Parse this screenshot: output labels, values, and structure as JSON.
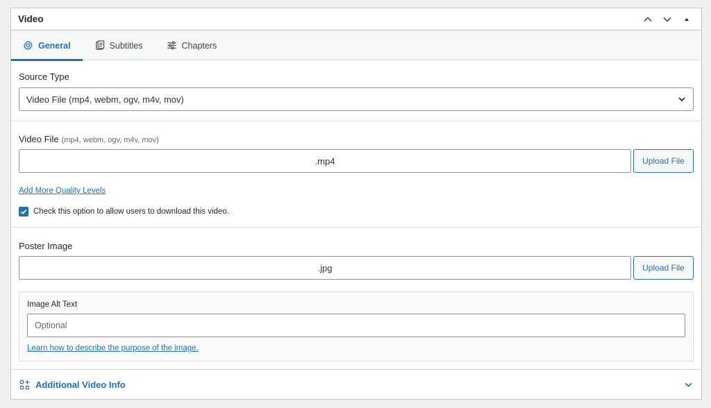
{
  "panel": {
    "title": "Video"
  },
  "tabs": [
    {
      "label": "General",
      "icon": "gear-icon",
      "active": true
    },
    {
      "label": "Subtitles",
      "icon": "subtitles-icon",
      "active": false
    },
    {
      "label": "Chapters",
      "icon": "sliders-icon",
      "active": false
    }
  ],
  "source_type": {
    "label": "Source Type",
    "selected": "Video File (mp4, webm, ogv, m4v, mov)"
  },
  "video_file": {
    "label": "Video File",
    "hint": "(mp4, webm, ogv, m4v, mov)",
    "value": ".mp4",
    "upload_label": "Upload File",
    "add_quality_link": "Add More Quality Levels",
    "download_checkbox_label": "Check this option to allow users to download this video.",
    "download_checked": true
  },
  "poster": {
    "label": "Poster Image",
    "value": ".jpg",
    "upload_label": "Upload File",
    "alt_label": "Image Alt Text",
    "alt_placeholder": "Optional",
    "alt_help_link": "Learn how to describe the purpose of the image."
  },
  "additional": {
    "label": "Additional Video Info"
  },
  "colors": {
    "accent": "#2271b1",
    "border": "#c3c4c7",
    "text": "#1d2327"
  }
}
